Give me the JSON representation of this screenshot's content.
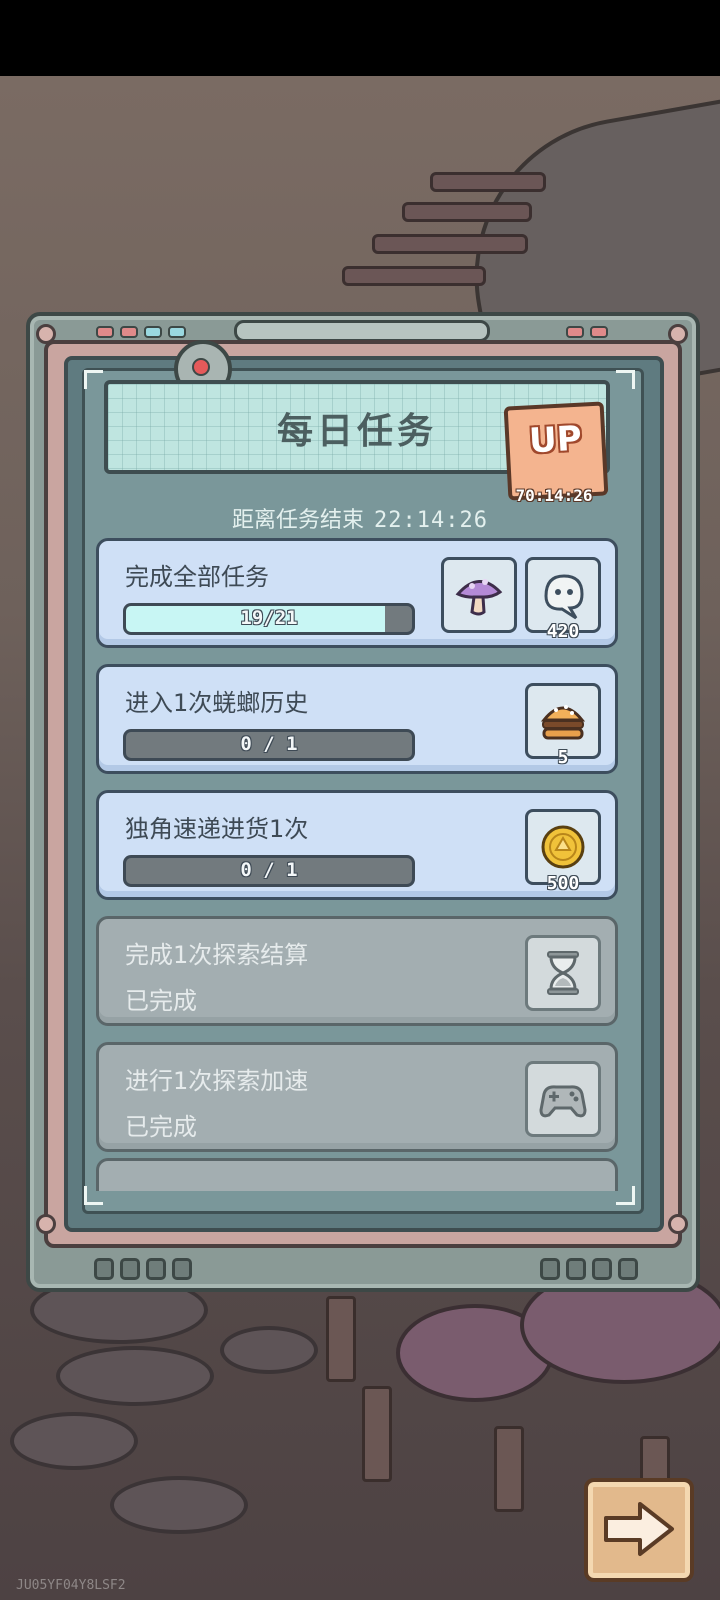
{
  "panel": {
    "title": "每日任务",
    "up_badge": {
      "label": "UP",
      "timer": "70:14:26"
    },
    "countdown": {
      "label": "距离任务结束",
      "time": "22:14:26"
    }
  },
  "tasks": [
    {
      "title": "完成全部任务",
      "progress": {
        "current": 19,
        "total": 21,
        "text": "19/21",
        "fraction": 0.905
      },
      "rewards": [
        {
          "icon": "mushroom-icon",
          "count": ""
        },
        {
          "icon": "ghost-icon",
          "count": "420"
        }
      ]
    },
    {
      "title": "进入1次蜣螂历史",
      "progress": {
        "current": 0,
        "total": 1,
        "text": "0 / 1",
        "fraction": 0
      },
      "rewards": [
        {
          "icon": "burger-icon",
          "count": "5"
        }
      ]
    },
    {
      "title": "独角速递进货1次",
      "progress": {
        "current": 0,
        "total": 1,
        "text": "0 / 1",
        "fraction": 0
      },
      "rewards": [
        {
          "icon": "coin-icon",
          "count": "500"
        }
      ]
    },
    {
      "title": "完成1次探索结算",
      "status": "已完成",
      "rewards": [
        {
          "icon": "hourglass-icon",
          "count": ""
        }
      ]
    },
    {
      "title": "进行1次探索加速",
      "status": "已完成",
      "rewards": [
        {
          "icon": "gamepad-icon",
          "count": ""
        }
      ]
    }
  ],
  "footer": {
    "watermark": "JU05YF04Y8LSF2"
  },
  "colors": {
    "accent_progress": "#c8f6f4",
    "card_active": "#cfe0f6",
    "card_done": "#a3aeb1",
    "badge": "#f4b48f"
  }
}
